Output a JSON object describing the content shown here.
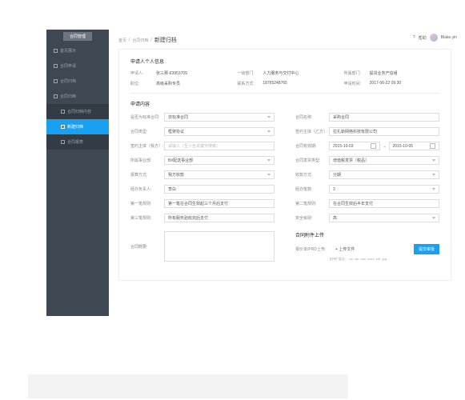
{
  "topbar": {
    "help": "帮助",
    "user": "Blake.yin",
    "help_icon": "?"
  },
  "sidebar": {
    "header": "合同管理",
    "items": [
      {
        "label": "首页展示"
      },
      {
        "label": "合同申请"
      },
      {
        "label": "合同归档"
      },
      {
        "label": "合同归档"
      }
    ],
    "subs": [
      {
        "label": "合同归档内容"
      },
      {
        "label": "新建归档"
      },
      {
        "label": "合同报表"
      }
    ]
  },
  "breadcrumb": {
    "a": "首页",
    "b": "合同归档",
    "c": "新建归档",
    "sep": "/"
  },
  "sec1": {
    "title": "申请人个人信息",
    "r1": [
      [
        "申请人:",
        "张三那-63953709"
      ],
      [
        "一级部门:",
        "人力服务与交付中心"
      ],
      [
        "所属部门:",
        "提货业务产信组"
      ]
    ],
    "r2": [
      [
        "职位:",
        "高级采购专员"
      ],
      [
        "联系方式:",
        "18765248765"
      ],
      [
        "申请时间:",
        "2017-06-22 09:30"
      ]
    ]
  },
  "sec2": {
    "title": "申请内容",
    "left": [
      [
        "是否为标准合同:",
        "非标准合同",
        "sel"
      ],
      [
        "合同类型:",
        "框架协议",
        "sel"
      ],
      [
        "签约主体（我方）:",
        "",
        "sel",
        "请输入（至少含关键字搜索）"
      ],
      [
        "所属事业部:",
        "B#配送事业部",
        "sel"
      ],
      [
        "报算方式:",
        "我方收款",
        "sel"
      ],
      [
        "经办负责人:",
        "李白",
        "txt"
      ],
      [
        "第一笔规则:",
        "第一笔在合同生效起三个月后支付",
        "txt"
      ],
      [
        "第三笔规则:",
        "所有服务验收完后支付",
        "txt"
      ]
    ],
    "right": [
      [
        "合同名称:",
        "采购合同",
        "txt"
      ],
      [
        "签约主体（乙方）:",
        "拉扎斯网络科技有限公司",
        "txt"
      ],
      [
        "合同有效期:",
        "2015-10-03",
        "2015-10-05",
        "drange"
      ],
      [
        "合同发票类型:",
        "增值税发票（税品）",
        "sel"
      ],
      [
        "收款方式:",
        "分期",
        "sel"
      ],
      [
        "经办笔数:",
        "3",
        "sel"
      ],
      [
        "第二笔规则:",
        "在合同生效后半年支付",
        "txt"
      ],
      [
        "安全级别:",
        "高",
        "sel"
      ]
    ],
    "summary": "合同概要:",
    "upload": {
      "title": "合同附件上传",
      "label": "报价单/PRD上传:",
      "btn": "+ 上传文件",
      "hint": "支持扩展名：.rar .zip .doc .docx .pdf .jpg...",
      "submit": "提交审批"
    }
  }
}
